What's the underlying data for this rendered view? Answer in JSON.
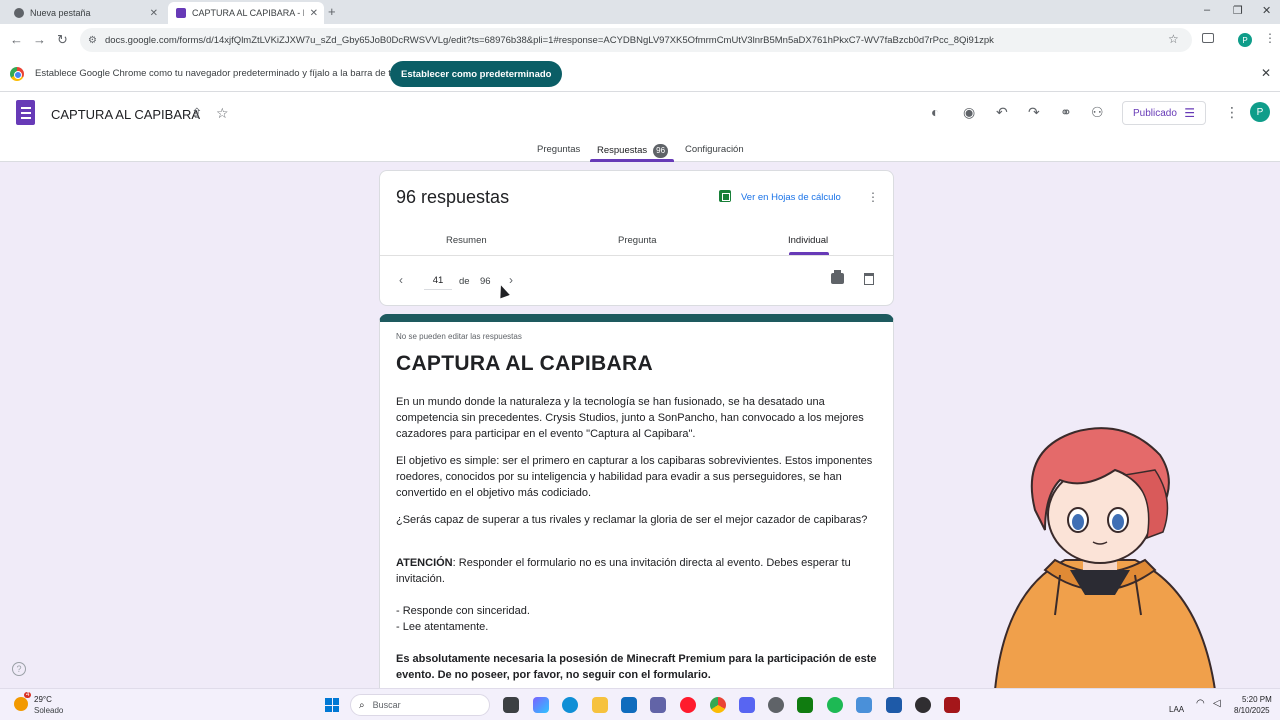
{
  "browser": {
    "tabs": [
      {
        "title": "Nueva pestaña"
      },
      {
        "title": "CAPTURA AL CAPIBARA - Form"
      }
    ],
    "url": "docs.google.com/forms/d/14xjfQlmZtLVKiZJXW7u_sZd_Gby65JoB0DcRWSVVLg/edit?ts=68976b38&pli=1#response=ACYDBNgLV97XK5OfmrmCmUtV3lnrB5Mn5aDX761hPkxC7-WV7faBzcb0d7rPcc_8Qi91zpk",
    "infobar": {
      "message": "Establece Google Chrome como tu navegador predeterminado y fíjalo a la barra de tareas",
      "button": "Establecer como predeterminado"
    },
    "profile_initial": "P"
  },
  "forms": {
    "title": "CAPTURA AL CAPIBARA",
    "publish_label": "Publicado",
    "avatar_initial": "P",
    "main_tabs": [
      {
        "label": "Preguntas"
      },
      {
        "label": "Respuestas",
        "badge": "96"
      },
      {
        "label": "Configuración"
      }
    ]
  },
  "responses": {
    "count_label": "96 respuestas",
    "sheets_link": "Ver en Hojas de cálculo",
    "subtabs": [
      "Resumen",
      "Pregunta",
      "Individual"
    ],
    "active_subtab": "Individual",
    "pager": {
      "current": "41",
      "of_label": "de",
      "total": "96"
    }
  },
  "form_content": {
    "notice": "No se pueden editar las respuestas",
    "title": "CAPTURA AL CAPIBARA",
    "p1": "En un mundo donde la naturaleza y la tecnología se han fusionado, se ha desatado una competencia sin precedentes. Crysis Studios, junto a SonPancho, han convocado a los mejores cazadores para participar en el evento \"Captura al Capibara\".",
    "p2": "El objetivo es simple: ser el primero en capturar a los capibaras sobrevivientes. Estos imponentes roedores, conocidos por su inteligencia y habilidad para evadir a sus perseguidores, se han convertido en el objetivo más codiciado.",
    "p3": "¿Serás capaz de superar a tus rivales y reclamar la gloria de ser el mejor cazador de capibaras?",
    "p4_bold": "ATENCIÓN",
    "p4_rest": ": Responder el formulario no es una invitación directa al evento. Debes esperar tu invitación.",
    "bullet1": "- Responde con sinceridad.",
    "bullet2": "- Lee atentamente.",
    "p5": "Es absolutamente necesaria la posesión de Minecraft Premium para la participación de este evento. De no poseer, por favor, no seguir con el formulario."
  },
  "taskbar": {
    "weather_temp": "29°C",
    "weather_desc": "Soleado",
    "weather_badge": "4",
    "search_placeholder": "Buscar",
    "lang": "LAA",
    "time": "5:20 PM",
    "date": "8/10/2025"
  },
  "colors": {
    "accent": "#673ab7",
    "form_header": "#1e5a5f",
    "infobar_button": "#0b5e66",
    "background": "#f0ebf8"
  }
}
